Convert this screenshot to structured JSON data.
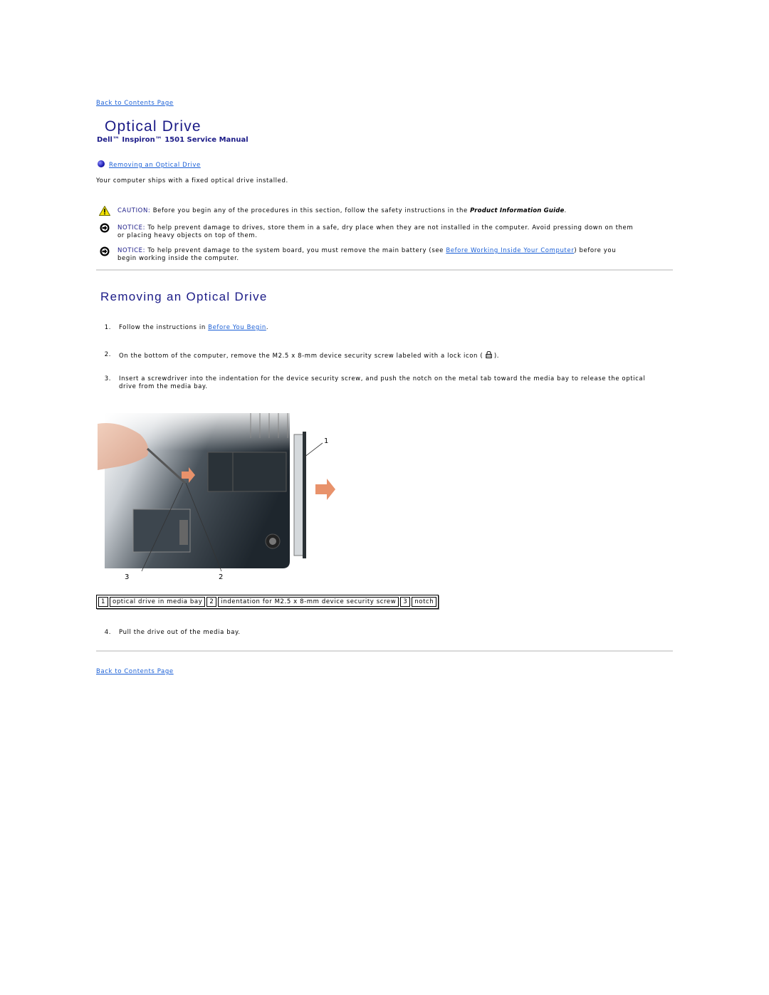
{
  "nav": {
    "back_top": "Back to Contents Page",
    "back_bottom": "Back to Contents Page"
  },
  "header": {
    "title": "Optical Drive",
    "subtitle": "Dell™ Inspiron™ 1501 Service Manual"
  },
  "toc": [
    {
      "label": "Removing an Optical Drive"
    }
  ],
  "intro": "Your computer ships with a fixed optical drive installed.",
  "caution": {
    "label": "CAUTION:",
    "text": " Before you begin any of the procedures in this section, follow the safety instructions in the ",
    "emphasis": "Product Information Guide",
    "end": "."
  },
  "notice1": {
    "label": "NOTICE:",
    "line1": " To help prevent damage to drives, store them in a safe, dry place when they are not installed in the computer. Avoid pressing down on them",
    "line2": "or placing heavy objects on top of them."
  },
  "notice2": {
    "label": "NOTICE:",
    "pre": " To help prevent damage to the system board, you must remove the main battery (see ",
    "link": "Before Working Inside Your Computer",
    "post": ") before you",
    "line2": "begin working inside the computer."
  },
  "section": {
    "heading": "Removing an Optical Drive",
    "steps": [
      {
        "num": "1.",
        "pre": "Follow the instructions in ",
        "link": "Before You Begin",
        "post": "."
      },
      {
        "num": "2.",
        "pre": "On the bottom of the computer, remove the M2.5 x 8-mm device security screw labeled with a lock icon ( ",
        "post": " )."
      },
      {
        "num": "3.",
        "line1": "Insert a screwdriver into the indentation for the device security screw, and push the notch on the metal tab toward the media bay to release the optical",
        "line2": "drive from the media bay."
      },
      {
        "num": "4.",
        "text": "Pull the drive out of the media bay."
      }
    ]
  },
  "figure": {
    "callouts": [
      "1",
      "2",
      "3"
    ]
  },
  "legend": [
    {
      "num": "1",
      "label": "optical drive in media bay"
    },
    {
      "num": "2",
      "label": "indentation for M2.5 x 8-mm device security screw"
    },
    {
      "num": "3",
      "label": "notch"
    }
  ],
  "colors": {
    "heading": "#1b1b87",
    "link": "#1a5fd6",
    "rule": "#d9d9d9"
  }
}
